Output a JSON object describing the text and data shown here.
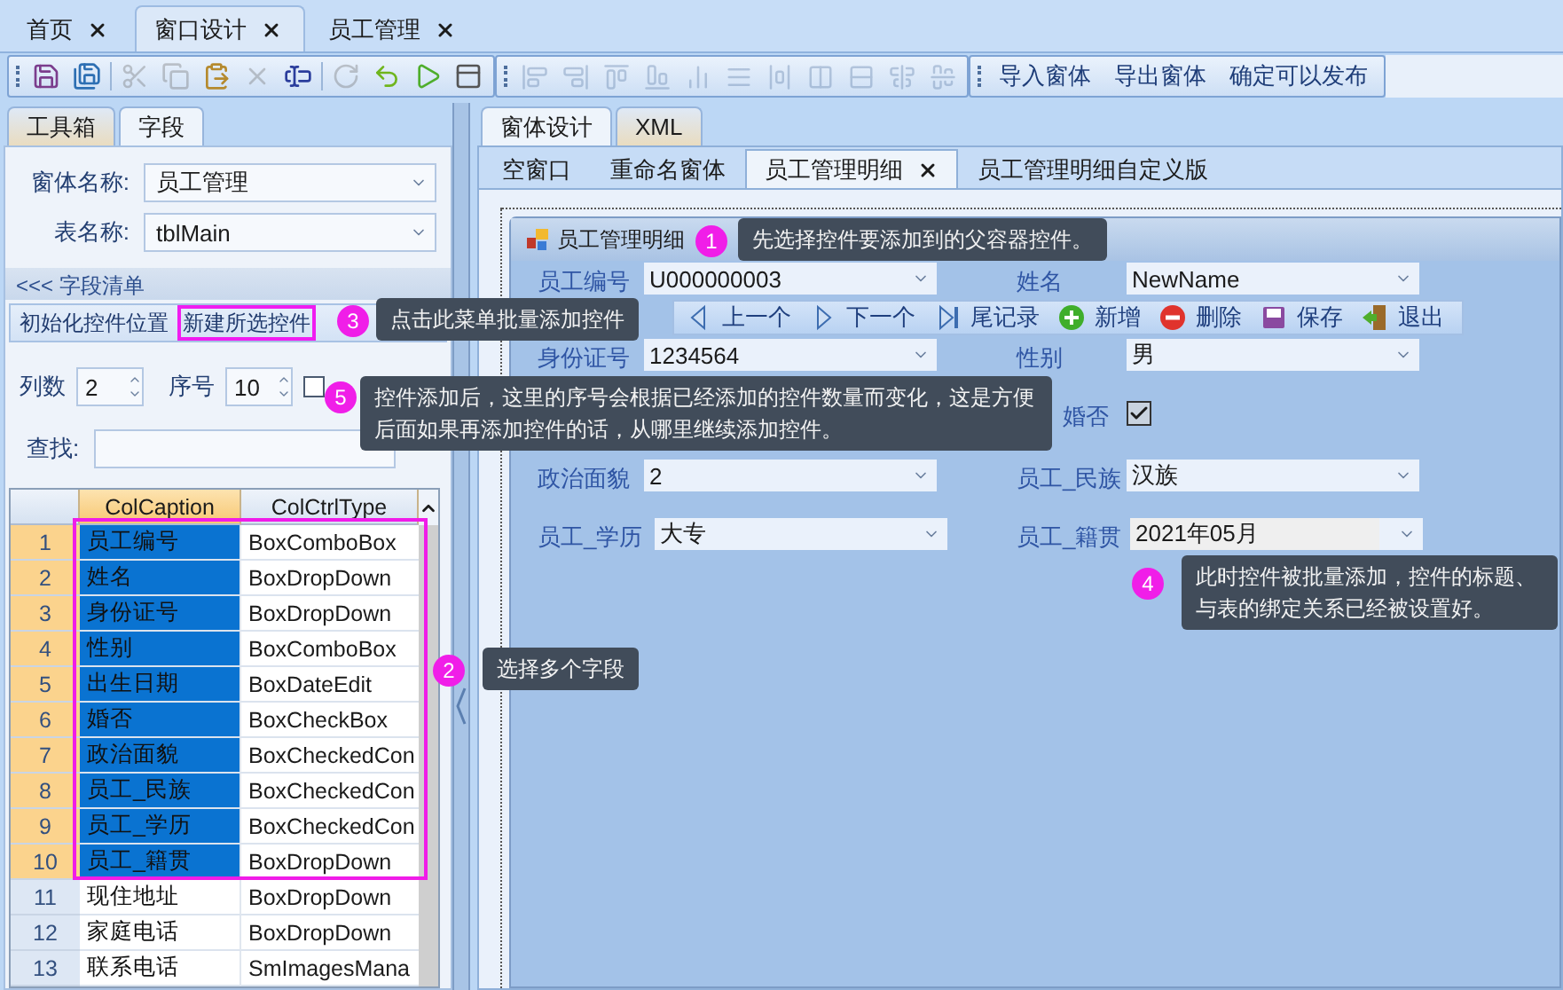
{
  "doc_tabs": [
    {
      "label": "首页",
      "selected": false
    },
    {
      "label": "窗口设计",
      "selected": true
    },
    {
      "label": "员工管理",
      "selected": false
    }
  ],
  "toolbar_buttons": [
    "导入窗体",
    "导出窗体",
    "确定可以发布"
  ],
  "left_panel": {
    "tabs": [
      {
        "label": "工具箱",
        "selected": false
      },
      {
        "label": "字段",
        "selected": true
      }
    ],
    "fields": [
      {
        "label": "窗体名称:",
        "value": "员工管理"
      },
      {
        "label": "表名称:",
        "value": "tblMain"
      }
    ],
    "section_title": "<<< 字段清单",
    "menu": [
      {
        "label": "初始化控件位置",
        "highlighted": false
      },
      {
        "label": "新建所选控件",
        "highlighted": true
      }
    ],
    "columns_label": "列数",
    "columns_value": "2",
    "index_label": "序号",
    "index_value": "10",
    "option_checked": false,
    "search_label": "查找:"
  },
  "grid": {
    "columns": [
      "ColCaption",
      "ColCtrlType"
    ],
    "rows": [
      {
        "num": "1",
        "caption": "员工编号",
        "type": "BoxComboBox",
        "selected": true
      },
      {
        "num": "2",
        "caption": "姓名",
        "type": "BoxDropDown",
        "selected": true
      },
      {
        "num": "3",
        "caption": "身份证号",
        "type": "BoxDropDown",
        "selected": true
      },
      {
        "num": "4",
        "caption": "性别",
        "type": "BoxComboBox",
        "selected": true
      },
      {
        "num": "5",
        "caption": "出生日期",
        "type": "BoxDateEdit",
        "selected": true
      },
      {
        "num": "6",
        "caption": "婚否",
        "type": "BoxCheckBox",
        "selected": true
      },
      {
        "num": "7",
        "caption": "政治面貌",
        "type": "BoxCheckedCon",
        "selected": true
      },
      {
        "num": "8",
        "caption": "员工_民族",
        "type": "BoxCheckedCon",
        "selected": true
      },
      {
        "num": "9",
        "caption": "员工_学历",
        "type": "BoxCheckedCon",
        "selected": true
      },
      {
        "num": "10",
        "caption": "员工_籍贯",
        "type": "BoxDropDown",
        "selected": true
      },
      {
        "num": "11",
        "caption": "现住地址",
        "type": "BoxDropDown",
        "selected": false
      },
      {
        "num": "12",
        "caption": "家庭电话",
        "type": "BoxDropDown",
        "selected": false
      },
      {
        "num": "13",
        "caption": "联系电话",
        "type": "SmImagesMana",
        "selected": false
      }
    ]
  },
  "right_panel": {
    "tabs": [
      {
        "label": "窗体设计",
        "selected": true
      },
      {
        "label": "XML",
        "selected": false
      }
    ],
    "design_tabs": [
      {
        "label": "空窗口",
        "selected": false
      },
      {
        "label": "重命名窗体",
        "selected": false
      },
      {
        "label": "员工管理明细",
        "selected": true
      },
      {
        "label": "员工管理明细自定义版",
        "selected": false
      }
    ]
  },
  "form_window": {
    "title": "员工管理明细",
    "controls": [
      {
        "kind": "combo",
        "label": "员工编号",
        "value": "U000000003"
      },
      {
        "kind": "combo",
        "label": "姓名",
        "value": "NewName"
      },
      {
        "kind": "combo",
        "label": "身份证号",
        "value": "1234564"
      },
      {
        "kind": "combo",
        "label": "性别",
        "value": "男"
      },
      {
        "kind": "check",
        "label": "婚否",
        "checked": true
      },
      {
        "kind": "combo",
        "label": "政治面貌",
        "value": "2"
      },
      {
        "kind": "combo",
        "label": "员工_民族",
        "value": "汉族"
      },
      {
        "kind": "combo",
        "label": "员工_学历",
        "value": "大专"
      },
      {
        "kind": "date",
        "label": "员工_籍贯",
        "value": "2021年05月"
      }
    ],
    "nav_toolbar": [
      {
        "kind": "prev",
        "label": "上一个"
      },
      {
        "kind": "next",
        "label": "下一个"
      },
      {
        "kind": "last",
        "label": "尾记录"
      },
      {
        "kind": "add",
        "label": "新增"
      },
      {
        "kind": "delete",
        "label": "删除"
      },
      {
        "kind": "save",
        "label": "保存"
      },
      {
        "kind": "exit",
        "label": "退出"
      }
    ]
  },
  "callouts": [
    {
      "number": "1",
      "text": "先选择控件要添加到的父容器控件。"
    },
    {
      "number": "3",
      "text": "点击此菜单批量添加控件"
    },
    {
      "number": "5",
      "text": "控件添加后，这里的序号会根据已经添加的控件数量而变化，这是方便后面如果再添加控件的话，从哪里继续添加控件。"
    },
    {
      "number": "4",
      "text": "此时控件被批量添加，控件的标题、与表的绑定关系已经被设置好。"
    },
    {
      "number": "2",
      "text": "选择多个字段"
    }
  ]
}
